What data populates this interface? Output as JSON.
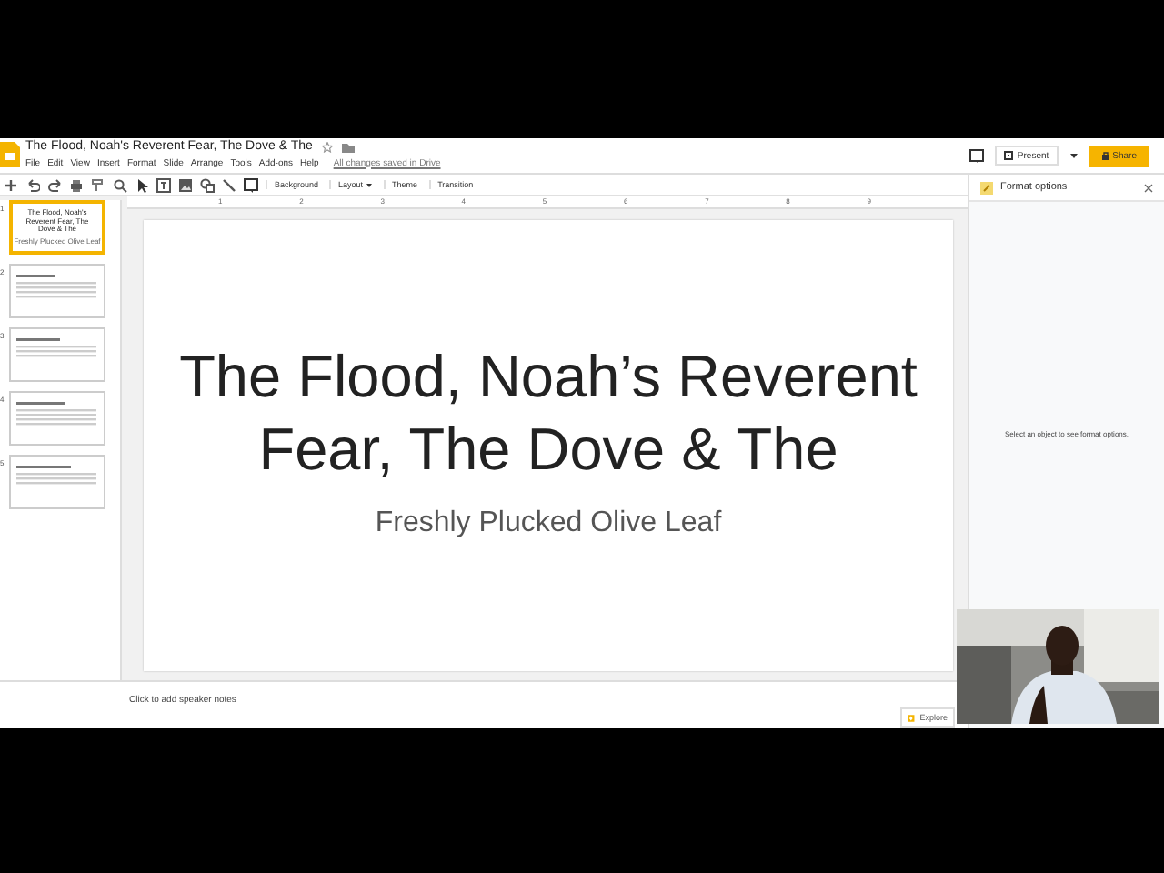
{
  "document": {
    "title": "The Flood, Noah's Reverent Fear, The Dove & The",
    "save_status": "All changes saved in Drive"
  },
  "menus": [
    "File",
    "Edit",
    "View",
    "Insert",
    "Format",
    "Slide",
    "Arrange",
    "Tools",
    "Add-ons",
    "Help"
  ],
  "header_buttons": {
    "present": "Present",
    "share": "Share"
  },
  "toolbar": [
    {
      "label": "Background",
      "kind": "plain"
    },
    {
      "label": "Layout",
      "kind": "dropdown"
    },
    {
      "label": "Theme",
      "kind": "plain"
    },
    {
      "label": "Transition",
      "kind": "plain"
    }
  ],
  "ruler": [
    "1",
    "2",
    "3",
    "4",
    "5",
    "6",
    "7",
    "8",
    "9"
  ],
  "slides": [
    {
      "number": "1",
      "selected": true,
      "title": "The Flood, Noah's Reverent Fear, The Dove & The",
      "subtitle": "Freshly Plucked Olive Leaf"
    },
    {
      "number": "2",
      "selected": false
    },
    {
      "number": "3",
      "selected": false
    },
    {
      "number": "4",
      "selected": false
    },
    {
      "number": "5",
      "selected": false
    }
  ],
  "canvas": {
    "title": "The Flood, Noah’s Reverent Fear, The Dove & The",
    "subtitle": "Freshly Plucked Olive Leaf"
  },
  "format_panel": {
    "title": "Format options",
    "hint": "Select an object to see format options."
  },
  "notes": {
    "placeholder": "Click to add speaker notes"
  },
  "explore": "Explore",
  "webcam": {
    "kind": "picture"
  }
}
